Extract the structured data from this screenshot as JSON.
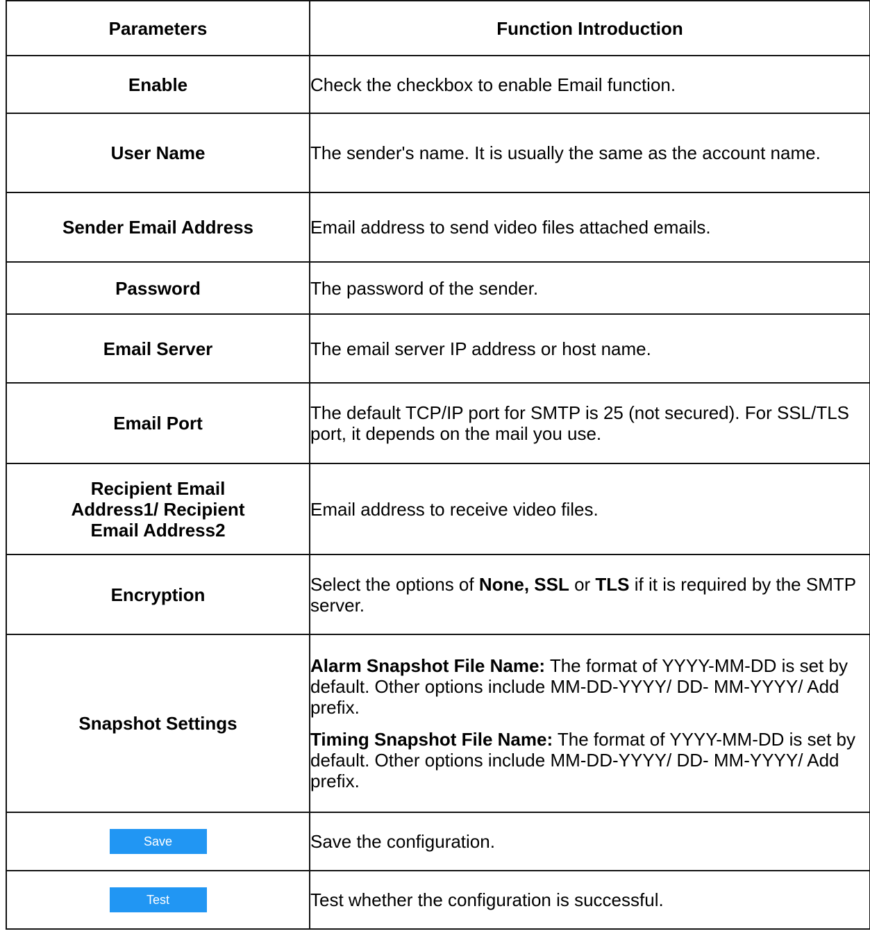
{
  "table": {
    "header": {
      "parameters": "Parameters",
      "function": "Function Introduction"
    },
    "rows": {
      "enable": {
        "param": "Enable",
        "desc": "Check the checkbox to enable Email function."
      },
      "user_name": {
        "param": "User Name",
        "desc": "The sender's name. It is usually the same as the account name."
      },
      "sender_email": {
        "param": "Sender Email Address",
        "desc": "Email address to send video files attached emails."
      },
      "password": {
        "param": "Password",
        "desc": "The password of the sender."
      },
      "email_server": {
        "param": "Email Server",
        "desc": "The email server IP address or host name."
      },
      "email_port": {
        "param": "Email Port",
        "desc": "The default TCP/IP port for SMTP is 25 (not secured). For SSL/TLS port, it depends on the mail you use."
      },
      "recipient": {
        "param": "Recipient Email Address1/ Recipient Email Address2",
        "desc": "Email address to receive video files."
      },
      "encryption": {
        "param": "Encryption",
        "desc_prefix": "Select the options of ",
        "opt_none_ssl": "None, SSL",
        "desc_or": " or ",
        "opt_tls": "TLS",
        "desc_suffix": " if it is required by the SMTP server."
      },
      "snapshot": {
        "param": "Snapshot Settings",
        "alarm_label": "Alarm Snapshot File Name:",
        "alarm_desc": " The format of YYYY-MM-DD is set by default. Other options include MM-DD-YYYY/ DD- MM-YYYY/ Add prefix.",
        "timing_label": "Timing Snapshot File Name:",
        "timing_desc": " The format of YYYY-MM-DD is set by default. Other options include MM-DD-YYYY/ DD- MM-YYYY/ Add prefix."
      },
      "save": {
        "button": "Save",
        "desc": "Save the configuration."
      },
      "test": {
        "button": "Test",
        "desc": "Test whether the configuration is successful."
      }
    }
  },
  "colors": {
    "button_bg": "#2196f3",
    "button_text": "#ffffff",
    "border": "#111111"
  }
}
